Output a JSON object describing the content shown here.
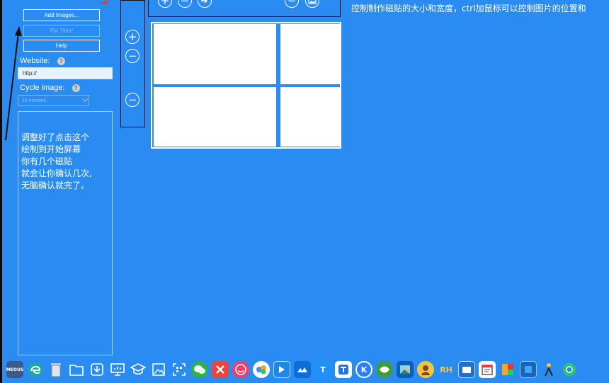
{
  "left_panel": {
    "add_images": "Add Images...",
    "pin_tiles": "Pin Tiles!",
    "help": "Help",
    "website_label": "Website:",
    "website_value": "http://",
    "cycle_label": "Cycle image:",
    "cycle_value": "15 minutes",
    "help_glyph": "?"
  },
  "annotation": {
    "note": "调整好了点击这个\n绘制到开始屏幕\n你有几个磁贴\n就会让你确认几次,\n无脑确认就完了。",
    "instruction": "控制制作磁贴的大小和宽度，ctrl加鼠标可以控制图片的位置和"
  },
  "tool_glyphs": {
    "plus": "+",
    "minus": "−"
  },
  "taskbar": {
    "start_label": "MEOUS",
    "rh_label": "RH",
    "t_label": "T",
    "k_label": "K",
    "icons": [
      "start-icon",
      "edge-icon",
      "recycle-bin-icon",
      "file-explorer-icon",
      "download-icon",
      "presentation-icon",
      "graduation-cap-icon",
      "image-icon",
      "qr-scan-icon",
      "wechat-icon",
      "xmind-icon",
      "face-app-icon",
      "baidu-netdisk-icon",
      "arrow-app-icon",
      "cloud-app-icon",
      "typora-icon",
      "tencent-meeting-icon",
      "k-app-icon",
      "leaf-app-icon",
      "photo-app-icon",
      "avatar-app-icon",
      "rh-app-icon",
      "blue-window-icon",
      "calendar-app-icon",
      "rainbow-app-icon",
      "blue-square-icon",
      "figure-app-icon",
      "chrome-like-icon"
    ],
    "colors": {
      "bar": "#2a8cf0",
      "background": "#2a8cf0",
      "arrow": "#111111",
      "red_arrow": "#e53935"
    }
  }
}
